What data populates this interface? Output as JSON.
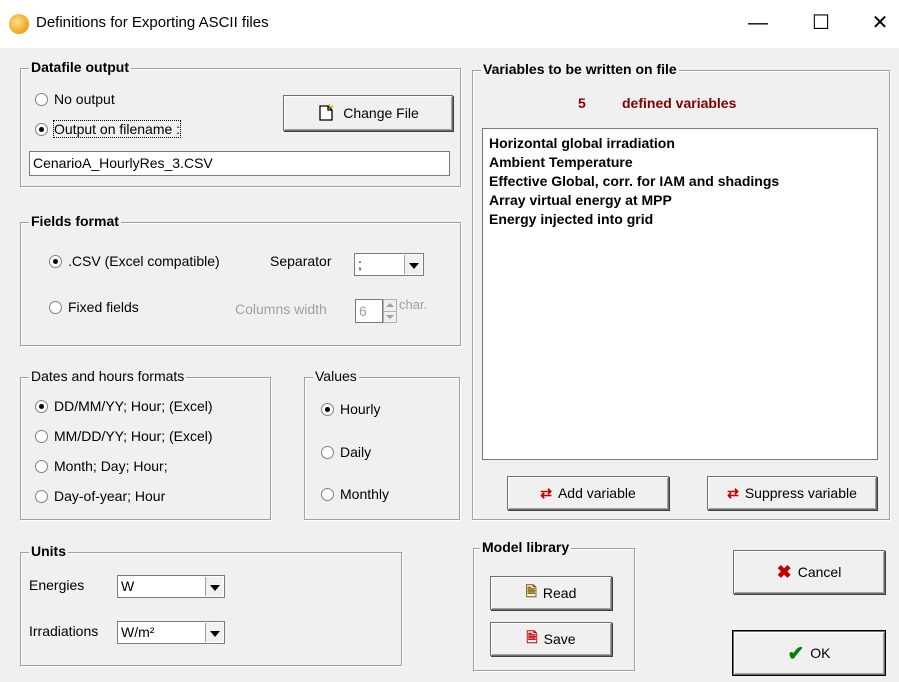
{
  "window": {
    "title": "Definitions for  Exporting  ASCII files",
    "minimize": "—",
    "maximize": "☐",
    "close": "✕"
  },
  "datafile": {
    "label": "Datafile output",
    "no_output": "No output",
    "output_on_filename": "Output on filename :",
    "change_file_button": "Change File",
    "filename": "CenarioA_HourlyRes_3.CSV",
    "selected": "output_on_filename"
  },
  "fields_format": {
    "label": "Fields format",
    "csv": ".CSV  (Excel compatible)",
    "separator_label": "Separator",
    "separator_value": ";",
    "fixed_fields": "Fixed fields",
    "columns_width_label": "Columns width",
    "columns_width_value": "6",
    "char_label": "char.",
    "selected": "csv"
  },
  "dates": {
    "label": "Dates and hours formats",
    "options": [
      "DD/MM/YY; Hour;  (Excel)",
      "MM/DD/YY; Hour;  (Excel)",
      "Month; Day; Hour;",
      "Day-of-year; Hour"
    ],
    "selected_index": 0
  },
  "values": {
    "label": "Values",
    "options": [
      "Hourly",
      "Daily",
      "Monthly"
    ],
    "selected_index": 0
  },
  "units": {
    "label": "Units",
    "energies_label": "Energies",
    "energies_value": "W",
    "irradiations_label": "Irradiations",
    "irradiations_value": "W/m²"
  },
  "variables": {
    "label": "Variables to be written on file",
    "count": "5",
    "count_text": "defined variables",
    "count_color": "#800000",
    "items": [
      "Horizontal global irradiation",
      "Ambient Temperature",
      "Effective Global, corr. for IAM and shadings",
      "Array virtual energy at MPP",
      "Energy injected into grid"
    ],
    "add_button": "Add variable",
    "suppress_button": "Suppress variable"
  },
  "model_library": {
    "label": "Model library",
    "read_button": "Read",
    "save_button": "Save"
  },
  "actions": {
    "cancel_button": "Cancel",
    "ok_button": "OK"
  },
  "icons": {
    "app": "pvsyst-sun-icon",
    "cancel": "red-x-icon",
    "ok": "green-check-icon"
  }
}
